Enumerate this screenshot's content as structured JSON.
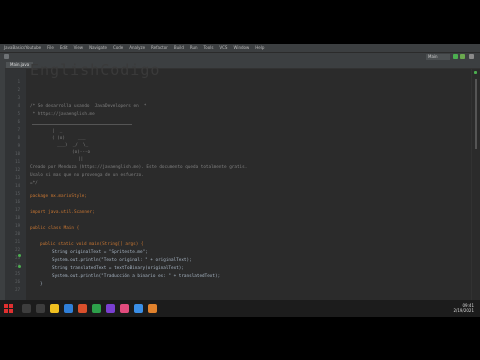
{
  "window": {
    "title": "JavaBasicsYoutube",
    "menu": [
      "File",
      "Edit",
      "View",
      "Navigate",
      "Code",
      "Analyze",
      "Refactor",
      "Build",
      "Run",
      "Tools",
      "VCS",
      "Window",
      "Help"
    ],
    "run_config": "Main"
  },
  "editor": {
    "tab_label": "Main.java",
    "ascii_banner": "EnglishCodigo",
    "comment_lines": [
      "/* Se desarrolla usando  JavaDevelopers en  *",
      " * https://javaenglish.me",
      "Creado por Mendoza (https://javaenglish.me). Este documento queda totalmente gratis.",
      "Usalo si mas que no provenga de un esfuerzo.",
      "=*/"
    ],
    "line_numbers": [
      "1",
      "2",
      "3",
      "4",
      "5",
      "6",
      "7",
      "8",
      "9",
      "10",
      "11",
      "12",
      "13",
      "14",
      "15",
      "16",
      "17",
      "18",
      "19",
      "20",
      "21",
      "22",
      "23",
      "24",
      "25",
      "26",
      "27"
    ],
    "code": {
      "package": "package mx.marioStyle;",
      "import": "import java.util.Scanner;",
      "class_decl": "public class Main {",
      "main_decl": "public static void main(String[] args) {",
      "line1": "String originalText = \"Spriteste.me\";",
      "line2": "System.out.println(\"Texto original: \" + originalText);",
      "line3": "String translatedText = textToBinary(originalText);",
      "line4": "System.out.println(\"Traducción a binario es: \" + translatedText);",
      "close": "}"
    }
  },
  "tool_windows": {
    "bottom": [
      "TODO",
      "Problems",
      "Terminal",
      "Build"
    ]
  },
  "taskbar": {
    "time": "09:41",
    "date": "2/19/2021"
  },
  "colors": {
    "editor_bg": "#2b2b2b",
    "keyword": "#cc7832",
    "string": "#6a8759",
    "comment": "#808080",
    "accent_red": "#e03030"
  }
}
